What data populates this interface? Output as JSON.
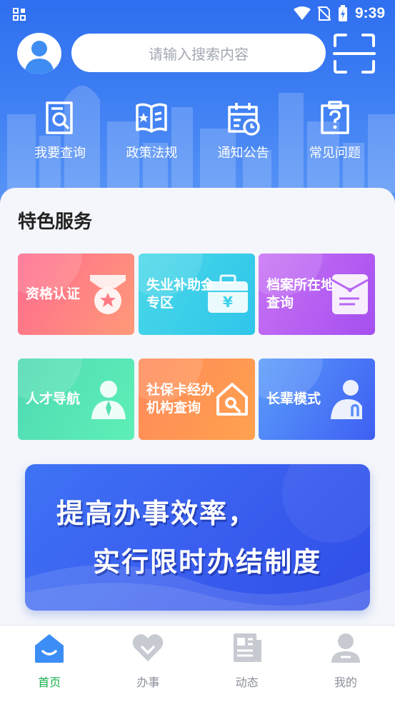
{
  "status_bar": {
    "time": "9:39"
  },
  "header": {
    "search": {
      "placeholder": "请输入搜索内容"
    },
    "quick_links": [
      {
        "label": "我要查询",
        "icon": "search-document-icon"
      },
      {
        "label": "政策法规",
        "icon": "policy-book-icon"
      },
      {
        "label": "通知公告",
        "icon": "calendar-clock-icon"
      },
      {
        "label": "常见问题",
        "icon": "question-clipboard-icon"
      }
    ]
  },
  "featured": {
    "title": "特色服务",
    "cards": [
      {
        "label": "资格认证",
        "icon": "medal-icon"
      },
      {
        "label": "失业补助金专区",
        "icon": "wallet-yuan-icon"
      },
      {
        "label": "档案所在地查询",
        "icon": "file-folder-icon"
      },
      {
        "label": "人才导航",
        "icon": "person-suit-icon"
      },
      {
        "label": "社保卡经办机构查询",
        "icon": "home-search-icon"
      },
      {
        "label": "长辈模式",
        "icon": "elder-person-icon"
      }
    ]
  },
  "banner": {
    "line1": "提高办事效率，",
    "line2": "实行限时办结制度"
  },
  "tab_bar": {
    "items": [
      {
        "label": "首页",
        "icon": "home-icon",
        "active": true
      },
      {
        "label": "办事",
        "icon": "heart-icon",
        "active": false
      },
      {
        "label": "动态",
        "icon": "news-icon",
        "active": false
      },
      {
        "label": "我的",
        "icon": "profile-icon",
        "active": false
      }
    ]
  },
  "colors": {
    "header_blue": "#2f6ff0",
    "active_tab": "#18b04c",
    "inactive_tab": "#8a8f99"
  }
}
